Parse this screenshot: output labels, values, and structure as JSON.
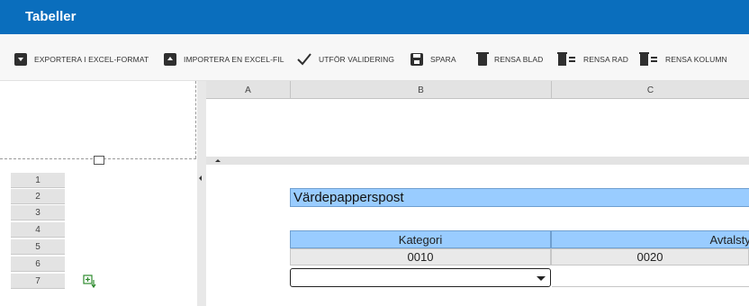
{
  "window": {
    "title": "Tabeller"
  },
  "toolbar": {
    "export_label": "EXPORTERA I EXCEL-FORMAT",
    "import_label": "IMPORTERA EN EXCEL-FIL",
    "validate_label": "UTFÖR VALIDERING",
    "save_label": "SPARA",
    "clear_sheet_label": "RENSA BLAD",
    "clear_row_label": "RENSA RAD",
    "clear_column_label": "RENSA KOLUMN",
    "icons": [
      "download-box-icon",
      "upload-box-icon",
      "check-icon",
      "floppy-icon",
      "trash-icon",
      "trash-rows-icon",
      "trash-columns-icon"
    ]
  },
  "sheet": {
    "columns": [
      "A",
      "B",
      "C"
    ],
    "rows": [
      "1",
      "2",
      "3",
      "4",
      "5",
      "6",
      "7"
    ],
    "section_title": "Värdepapperspost",
    "headers": [
      "Kategori",
      "Avtalstyp"
    ],
    "values": [
      "0010",
      "0020"
    ],
    "dropdown_value": ""
  },
  "colors": {
    "titlebar": "#0a6ebd",
    "header_fill": "#99ccff",
    "value_fill": "#e9e9e9"
  }
}
